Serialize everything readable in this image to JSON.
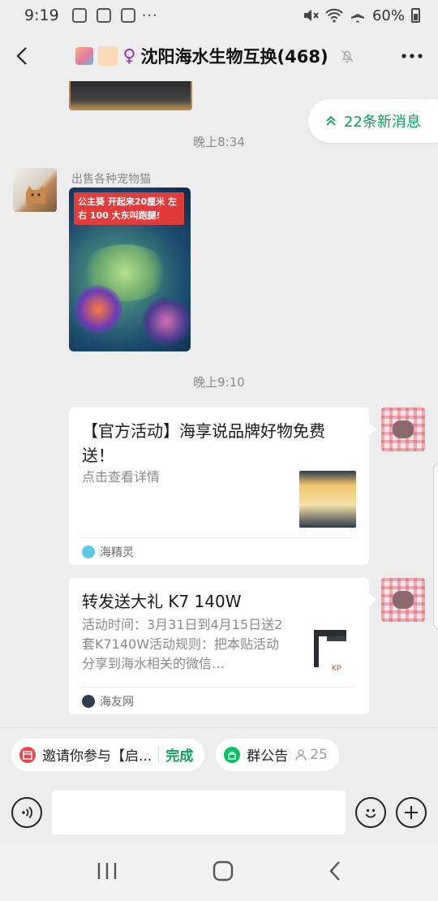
{
  "status_bar": {
    "time": "9:19",
    "battery": "60%",
    "icons_left": [
      "upload-icon",
      "translate-icon",
      "app-icon"
    ],
    "icons_right": [
      "mute-icon",
      "wifi-icon",
      "airplane-icon",
      "battery-icon"
    ]
  },
  "header": {
    "title": "沈阳海水生物互换(468)",
    "title_prefix": "♀",
    "muted": true
  },
  "chat": {
    "new_messages": "22条新消息",
    "timestamp_1": "晚上8:34",
    "sender_1": "出售各种宠物猫",
    "image_caption": "公主葵 开起来20厘米 左右 100 大东叫跑腿!",
    "timestamp_2": "晚上9:10",
    "cards": [
      {
        "title": "【官方活动】海享说品牌好物免费送！",
        "desc": "点击查看详情",
        "source": "海精灵"
      },
      {
        "title": "转发送大礼 K7 140W",
        "desc": "活动时间：3月31日到4月15日送2套K7140W活动规则：把本贴活动分享到海水相关的微信…",
        "source": "海友网"
      }
    ]
  },
  "chips": {
    "invite": "邀请你参与【启...",
    "done": "完成",
    "notice": "群公告",
    "notice_count": "25"
  },
  "colors": {
    "accent_green": "#07a35a",
    "background": "#ededed"
  }
}
